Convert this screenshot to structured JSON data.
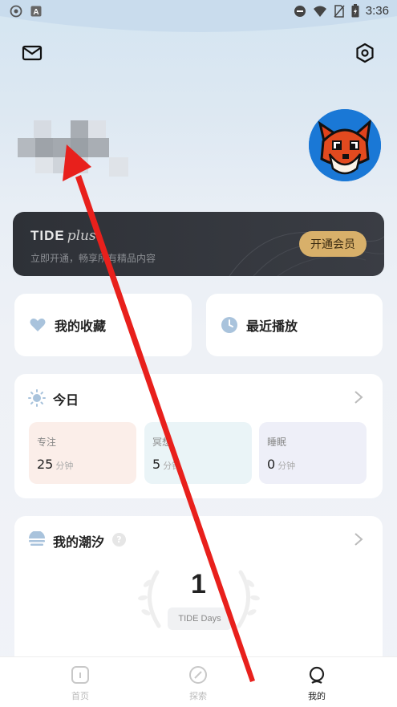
{
  "status_bar": {
    "time": "3:36"
  },
  "header": {
    "mail_icon": "mail-icon",
    "settings_icon": "settings-icon"
  },
  "vip": {
    "brand": "TIDE",
    "brand_plus": "plus",
    "subtitle": "立即开通，畅享所有精品内容",
    "button": "开通会员"
  },
  "quick_links": [
    {
      "label": "我的收藏",
      "icon": "heart-icon"
    },
    {
      "label": "最近播放",
      "icon": "clock-icon"
    }
  ],
  "today": {
    "title": "今日",
    "stats": [
      {
        "name": "专注",
        "value": "25",
        "unit": "分钟",
        "color": "#fbeee9"
      },
      {
        "name": "冥想",
        "value": "5",
        "unit": "分钟",
        "color": "#eaf4f7"
      },
      {
        "name": "睡眠",
        "value": "0",
        "unit": "分钟",
        "color": "#eeeff8"
      }
    ]
  },
  "tide": {
    "title": "我的潮汐",
    "help": "?",
    "count": "1",
    "pill": "TIDE Days"
  },
  "tabbar": {
    "tabs": [
      {
        "label": "首页",
        "icon": "home-icon"
      },
      {
        "label": "探索",
        "icon": "compass-icon"
      },
      {
        "label": "我的",
        "icon": "profile-icon"
      }
    ],
    "active_index": 2
  },
  "colors": {
    "vip_gold": "#d8b06a",
    "annotation_arrow": "#e8201c"
  }
}
